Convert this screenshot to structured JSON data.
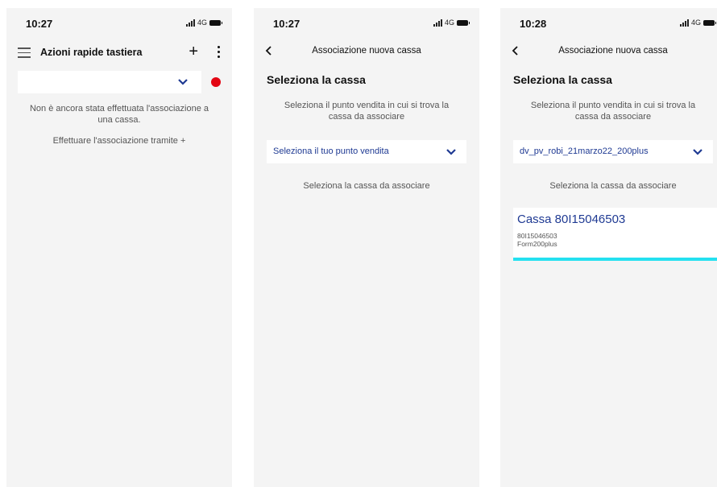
{
  "screens": [
    {
      "time": "10:27",
      "network": "4G",
      "header_title": "Azioni rapide tastiera",
      "plus_label": "+",
      "empty_line1": "Non è ancora stata effettuata l'associazione a",
      "empty_line2": "una cassa.",
      "hint": "Effettuare l'associazione tramite +",
      "status_dot_color": "#e30613"
    },
    {
      "time": "10:27",
      "network": "4G",
      "nav_title": "Associazione nuova cassa",
      "section_title": "Seleziona la cassa",
      "desc_line1": "Seleziona il punto vendita in cui si trova la",
      "desc_line2": "cassa da associare",
      "store_select": "Seleziona il tuo punto vendita",
      "cassa_hint": "Seleziona la cassa da associare"
    },
    {
      "time": "10:28",
      "network": "4G",
      "nav_title": "Associazione nuova cassa",
      "section_title": "Seleziona la cassa",
      "desc_line1": "Seleziona il punto vendita in cui si trova la",
      "desc_line2": "cassa da associare",
      "store_select": "dv_pv_robi_21marzo22_200plus",
      "cassa_hint": "Seleziona la cassa da associare",
      "cassa": {
        "title": "Cassa 80I15046503",
        "serial": "80I15046503",
        "model": "Form200plus"
      }
    }
  ],
  "colors": {
    "accent_blue": "#1f3a93",
    "selection_cyan": "#24e0f0",
    "background": "#f4f4f4"
  },
  "icons": [
    "hamburger-icon",
    "plus-icon",
    "more-vertical-icon",
    "chevron-down-icon",
    "back-arrow-icon",
    "signal-icon",
    "battery-icon"
  ]
}
